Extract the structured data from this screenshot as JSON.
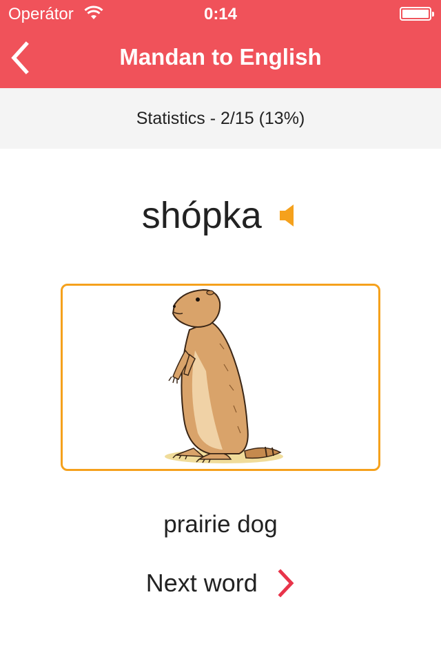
{
  "status_bar": {
    "carrier": "Operátor",
    "time": "0:14"
  },
  "nav": {
    "title": "Mandan to English",
    "back_icon": "chevron-left-icon"
  },
  "stats": {
    "text": "Statistics - 2/15 (13%)"
  },
  "card": {
    "word": "shópka",
    "speaker_icon": "speaker-icon",
    "image": "prairie-dog-illustration",
    "answer": "prairie dog"
  },
  "next": {
    "label": "Next word",
    "icon": "chevron-right-icon"
  },
  "colors": {
    "header": "#f0525a",
    "accent": "#f5a11c",
    "stats_bg": "#f4f4f4",
    "next_chevron": "#e8344a"
  }
}
